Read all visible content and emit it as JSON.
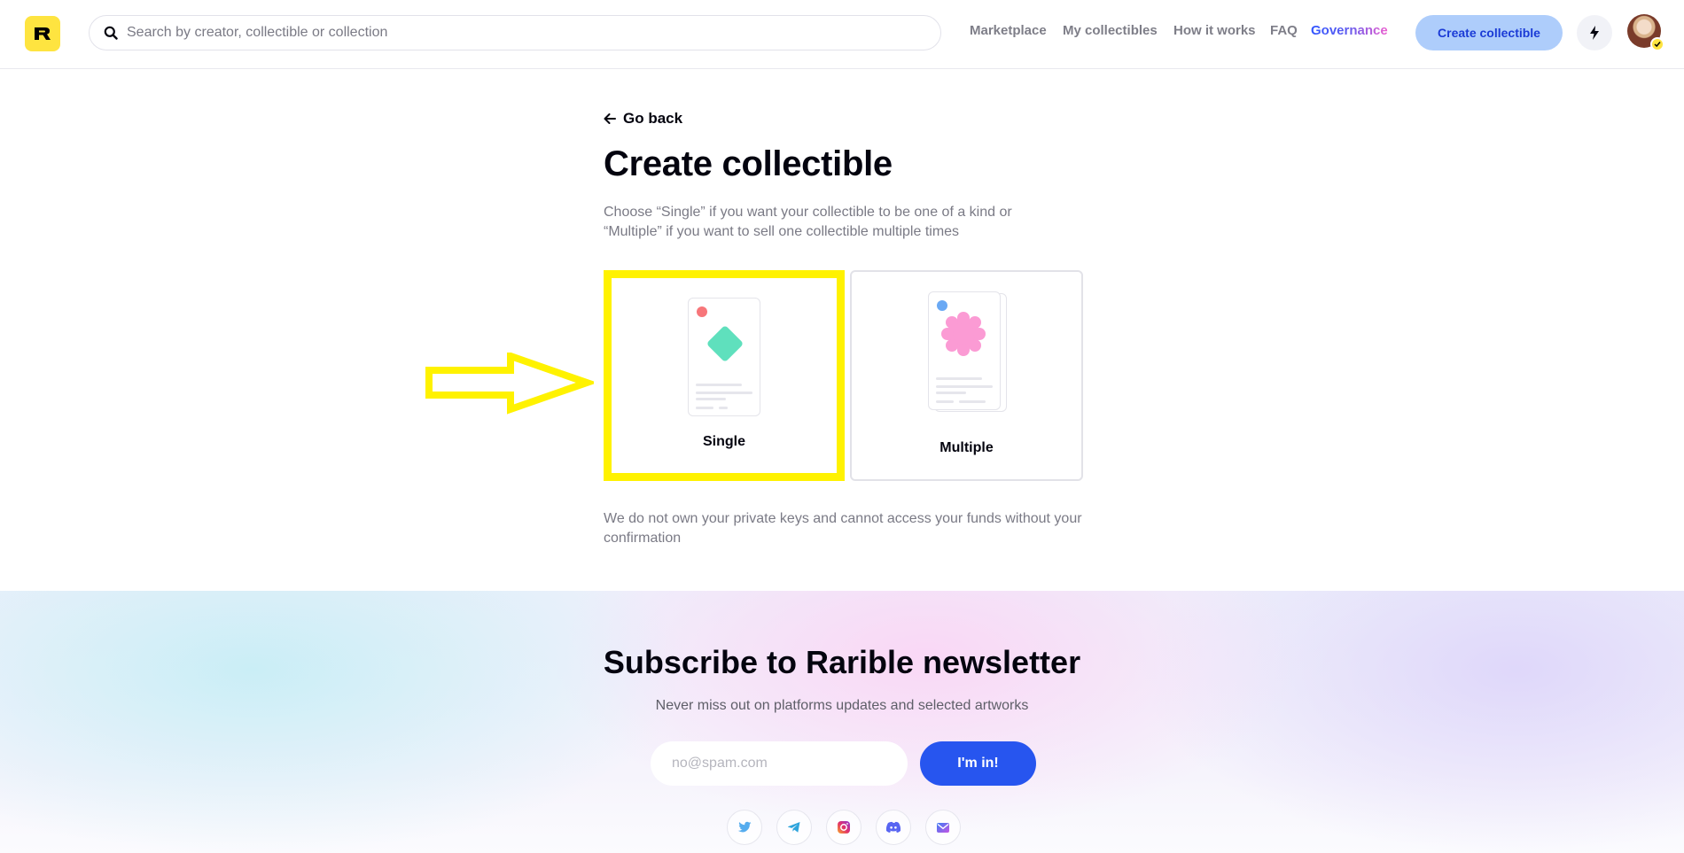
{
  "header": {
    "logo_icon": "rarible-logo-icon",
    "search": {
      "placeholder": "Search by creator, collectible or collection"
    },
    "nav": [
      {
        "label": "Marketplace"
      },
      {
        "label": "My collectibles"
      },
      {
        "label": "How it works"
      },
      {
        "label": "FAQ"
      },
      {
        "label": "Governance"
      }
    ],
    "create_label": "Create collectible",
    "bolt_icon": "lightning-icon",
    "avatar_icon": "user-avatar"
  },
  "main": {
    "back_label": "Go back",
    "title": "Create collectible",
    "description": "Choose “Single” if you want your collectible to be one of a kind or “Multiple” if you want to sell one collectible multiple times",
    "options": [
      {
        "label": "Single",
        "highlighted": true
      },
      {
        "label": "Multiple",
        "highlighted": false
      }
    ],
    "disclaimer": "We do not own your private keys and cannot access your funds without your confirmation"
  },
  "newsletter": {
    "title": "Subscribe to Rarible newsletter",
    "subtitle": "Never miss out on platforms updates and selected artworks",
    "email_placeholder": "no@spam.com",
    "submit_label": "I'm in!",
    "socials": [
      "twitter-icon",
      "telegram-icon",
      "instagram-icon",
      "discord-icon",
      "mail-icon"
    ]
  },
  "colors": {
    "accent_blue": "#2755ef",
    "highlight_yellow": "#fff200",
    "logo_yellow": "#fee440"
  }
}
